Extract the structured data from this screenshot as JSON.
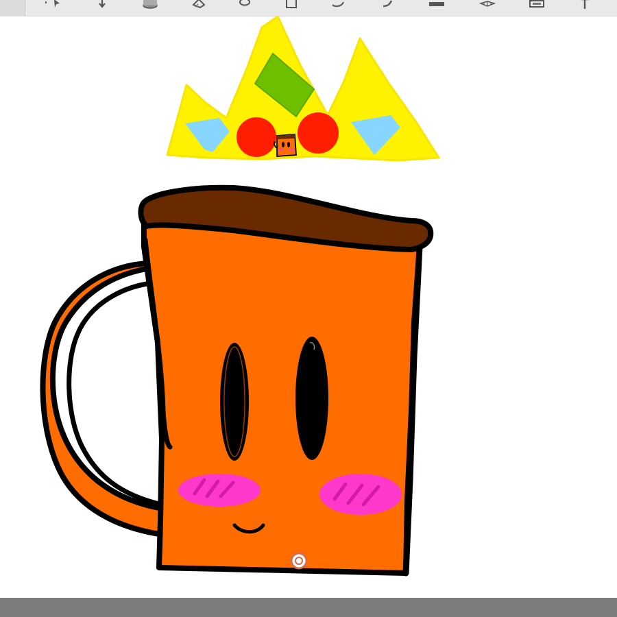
{
  "toolbar": {
    "tools": [
      {
        "name": "select-arrow-icon"
      },
      {
        "name": "move-down-icon"
      },
      {
        "name": "bucket-icon"
      },
      {
        "name": "eraser-icon"
      },
      {
        "name": "transform-icon"
      },
      {
        "name": "layer-icon"
      },
      {
        "name": "lasso-icon"
      },
      {
        "name": "curve-icon"
      },
      {
        "name": "rectangle-icon"
      },
      {
        "name": "grid-icon"
      },
      {
        "name": "frame-icon"
      },
      {
        "name": "text-icon",
        "label": "T"
      }
    ]
  },
  "canvas": {
    "background_color": "#ffffff"
  },
  "drawing": {
    "crown_color": "#fff200",
    "gem_green": "#6cc000",
    "gem_blue": "#86d6ff",
    "gem_red": "#ff1e00",
    "mug_color": "#ff6d00",
    "coffee_color": "#6a2a00",
    "blush_color": "#ff38cc",
    "outline_color": "#000000"
  },
  "bottom_bar": {
    "color": "#7d7d7d"
  }
}
